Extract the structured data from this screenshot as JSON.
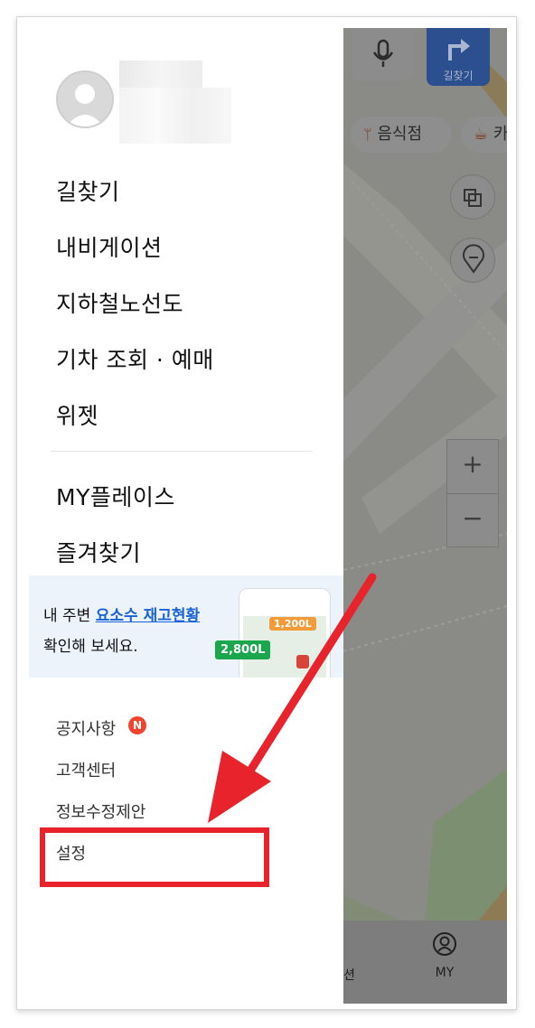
{
  "map": {
    "route_label": "길찾기",
    "chips": [
      "음식점",
      "카"
    ],
    "zoom_in": "+",
    "zoom_out": "−"
  },
  "drawer": {
    "main_menu": [
      "길찾기",
      "내비게이션",
      "지하철노선도",
      "기차 조회 · 예매",
      "위젯"
    ],
    "my_menu": [
      "MY플레이스",
      "즐겨찾기"
    ],
    "banner": {
      "line1_prefix": "내 주변 ",
      "line1_highlight": "요소수 재고현황",
      "line2": "확인해 보세요.",
      "tag_small": "1,200L",
      "tag_big": "2,800L"
    },
    "sub_menu": [
      "공지사항",
      "고객센터",
      "정보수정제안",
      "설정"
    ],
    "notice_badge": "N"
  },
  "tabbar": {
    "left_partial": "션",
    "my_label": "MY"
  },
  "colors": {
    "annotation_red": "#e8232b",
    "highlight_blue": "#1a63d6",
    "badge_red": "#f0442e",
    "route_button": "#2b4f8f"
  }
}
